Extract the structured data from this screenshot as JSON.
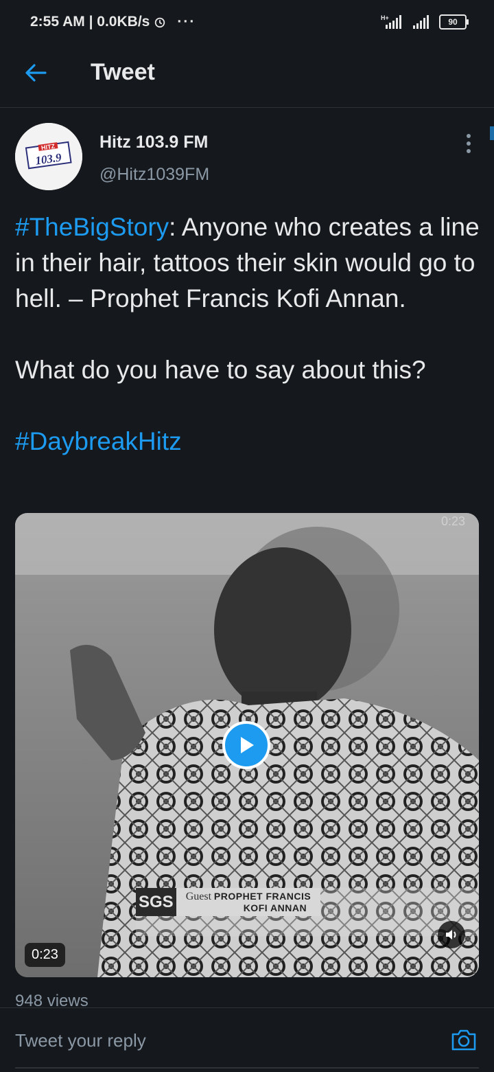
{
  "status_bar": {
    "time": "2:55 AM",
    "speed": "0.0KB/s",
    "more": "···",
    "network": "H+",
    "battery": "90"
  },
  "header": {
    "title": "Tweet"
  },
  "tweet": {
    "author_name": "Hitz 103.9 FM",
    "author_handle": "@Hitz1039FM",
    "avatar_text": "HITZ 103.9",
    "hashtag_1": "#TheBigStory",
    "text_1": ": Anyone who creates a line in their hair, tattoos their skin would go to hell. – Prophet Francis Kofi Annan.",
    "text_2": "What do you have to say about this?",
    "hashtag_2": "#DaybreakHitz",
    "views": "948 views"
  },
  "media": {
    "duration_top": "0:23",
    "duration": "0:23",
    "channel": "SGS",
    "guest_label": "Guest",
    "guest_name_line1": "PROPHET FRANCIS",
    "guest_name_line2": "KOFI ANNAN"
  },
  "reply": {
    "placeholder": "Tweet your reply"
  },
  "colors": {
    "background": "#15181c",
    "accent": "#1d9bf0",
    "secondary_text": "#8b98a5"
  }
}
